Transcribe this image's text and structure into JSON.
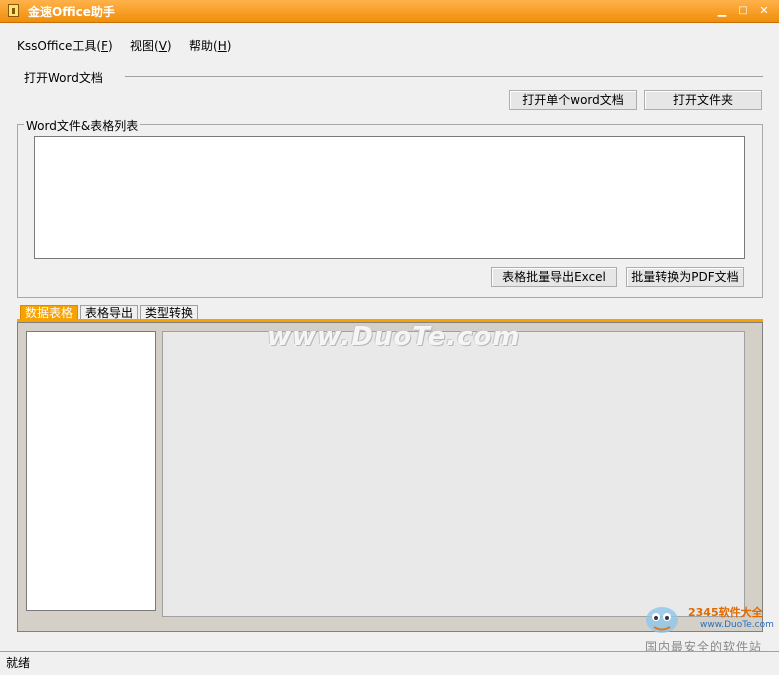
{
  "window": {
    "title": "金速Office助手",
    "minimize": "▁",
    "maximize": "□",
    "close": "✕",
    "accent": "#f6a200"
  },
  "menu": {
    "items": [
      {
        "label": "KssOffice工具",
        "key": "F"
      },
      {
        "label": "视图",
        "key": "V"
      },
      {
        "label": "帮助",
        "key": "H"
      }
    ]
  },
  "open_section": {
    "label": "打开Word文档",
    "open_single_button": "打开单个word文档",
    "open_folder_button": "打开文件夹"
  },
  "file_group": {
    "label": "Word文件&表格列表",
    "export_excel_button": "表格批量导出Excel",
    "convert_pdf_button": "批量转换为PDF文档"
  },
  "tabs": [
    {
      "label": "数据表格",
      "active": true
    },
    {
      "label": "表格导出",
      "active": false
    },
    {
      "label": "类型转换",
      "active": false
    }
  ],
  "watermark": {
    "text": "www.DuoTe.com",
    "badge_name": "2345软件大全",
    "badge_url": "www.DuoTe.com",
    "badge_slogan": "国内最安全的软件站"
  },
  "status": {
    "text": "就绪"
  }
}
